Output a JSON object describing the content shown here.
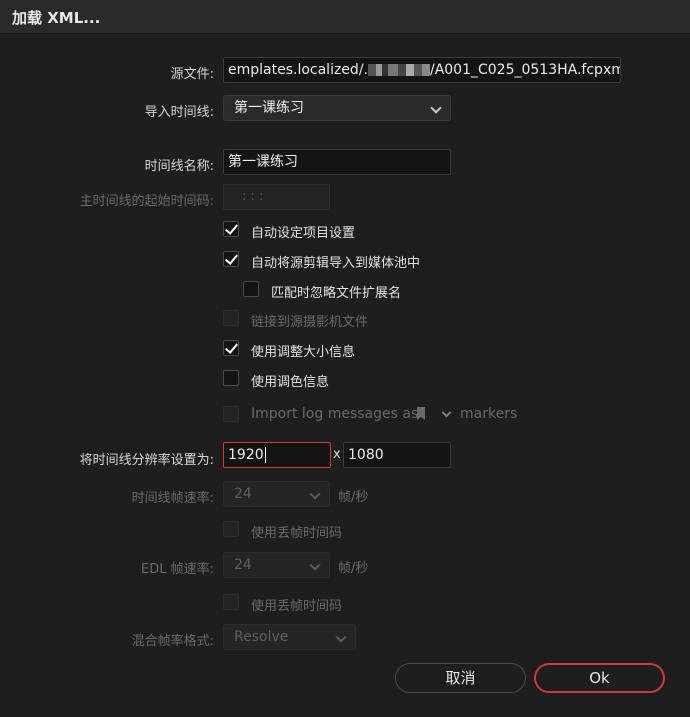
{
  "dialog": {
    "title": "加载 XML..."
  },
  "source": {
    "label": "源文件:",
    "value_prefix": "emplates.localized/.",
    "value_suffix": "/A001_C025_0513HA.fcpxml"
  },
  "import_timeline": {
    "label": "导入时间线:",
    "value": "第一课练习"
  },
  "timeline_name": {
    "label": "时间线名称:",
    "value": "第一课练习"
  },
  "start_timecode": {
    "label": "主时间线的起始时间码:",
    "placeholder": ": : :"
  },
  "checkboxes": {
    "auto_project": {
      "label": "自动设定项目设置",
      "checked": true
    },
    "auto_import": {
      "label": "自动将源剪辑导入到媒体池中",
      "checked": true
    },
    "ignore_ext": {
      "label": "匹配时忽略文件扩展名",
      "checked": false
    },
    "link_camera": {
      "label": "链接到源摄影机文件",
      "checked": false
    },
    "use_resize": {
      "label": "使用调整大小信息",
      "checked": true
    },
    "use_color": {
      "label": "使用调色信息",
      "checked": false
    }
  },
  "import_log": {
    "prefix": "Import log messages as",
    "suffix": "markers"
  },
  "resolution": {
    "label": "将时间线分辨率设置为:",
    "width": "1920",
    "separator": "x",
    "height": "1080"
  },
  "timeline_fps": {
    "label": "时间线帧速率:",
    "value": "24",
    "unit": "帧/秒"
  },
  "drop_frame_1": {
    "label": "使用丢帧时间码"
  },
  "edl_fps": {
    "label": "EDL 帧速率:",
    "value": "24",
    "unit": "帧/秒"
  },
  "drop_frame_2": {
    "label": "使用丢帧时间码"
  },
  "mixed_fps": {
    "label": "混合帧率格式:",
    "value": "Resolve"
  },
  "buttons": {
    "cancel": "取消",
    "ok": "Ok"
  }
}
